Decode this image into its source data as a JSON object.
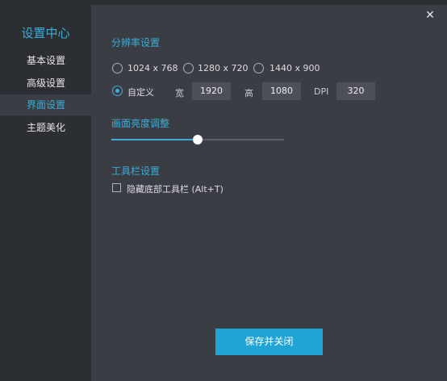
{
  "window": {
    "close_glyph": "✕"
  },
  "sidebar": {
    "title": "设置中心",
    "items": [
      {
        "label": "基本设置",
        "active": false
      },
      {
        "label": "高级设置",
        "active": false
      },
      {
        "label": "界面设置",
        "active": true
      },
      {
        "label": "主题美化",
        "active": false
      }
    ]
  },
  "resolution": {
    "title": "分辨率设置",
    "options": [
      {
        "label": "1024 x 768",
        "checked": false
      },
      {
        "label": "1280 x 720",
        "checked": false
      },
      {
        "label": "1440 x 900",
        "checked": false
      },
      {
        "label": "自定义",
        "checked": true
      }
    ],
    "width_label": "宽",
    "width_value": "1920",
    "height_label": "高",
    "height_value": "1080",
    "dpi_label": "DPI",
    "dpi_value": "320"
  },
  "brightness": {
    "title": "画面亮度调整",
    "level": 0.5
  },
  "toolbar": {
    "title": "工具栏设置",
    "hide_bottom_label": "隐藏底部工具栏 (Alt+T)",
    "hide_bottom_checked": false
  },
  "footer": {
    "save_label": "保存并关闭"
  },
  "colors": {
    "accent": "#3aaed8",
    "button": "#22a3d5",
    "sidebar_bg": "#2b2e33",
    "panel_bg": "#3a3d44"
  }
}
